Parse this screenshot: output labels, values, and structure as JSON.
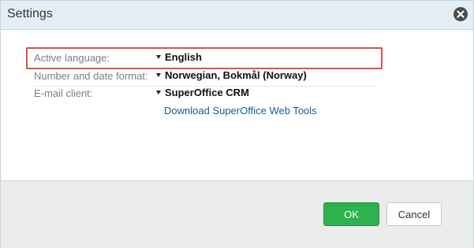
{
  "dialog": {
    "title": "Settings",
    "close_icon": "close-circle-icon"
  },
  "settings": [
    {
      "label": "Active language:",
      "value": "English"
    },
    {
      "label": "Number and date format:",
      "value": "Norwegian, Bokmål (Norway)"
    },
    {
      "label": "E-mail client:",
      "value": "SuperOffice CRM"
    }
  ],
  "download_link": "Download SuperOffice Web Tools",
  "buttons": {
    "ok": "OK",
    "cancel": "Cancel"
  },
  "colors": {
    "titlebar": "#e3eef5",
    "highlight": "#d9534f",
    "ok_button": "#2eb14f",
    "link": "#1b5a8c",
    "footer": "#ececec"
  }
}
